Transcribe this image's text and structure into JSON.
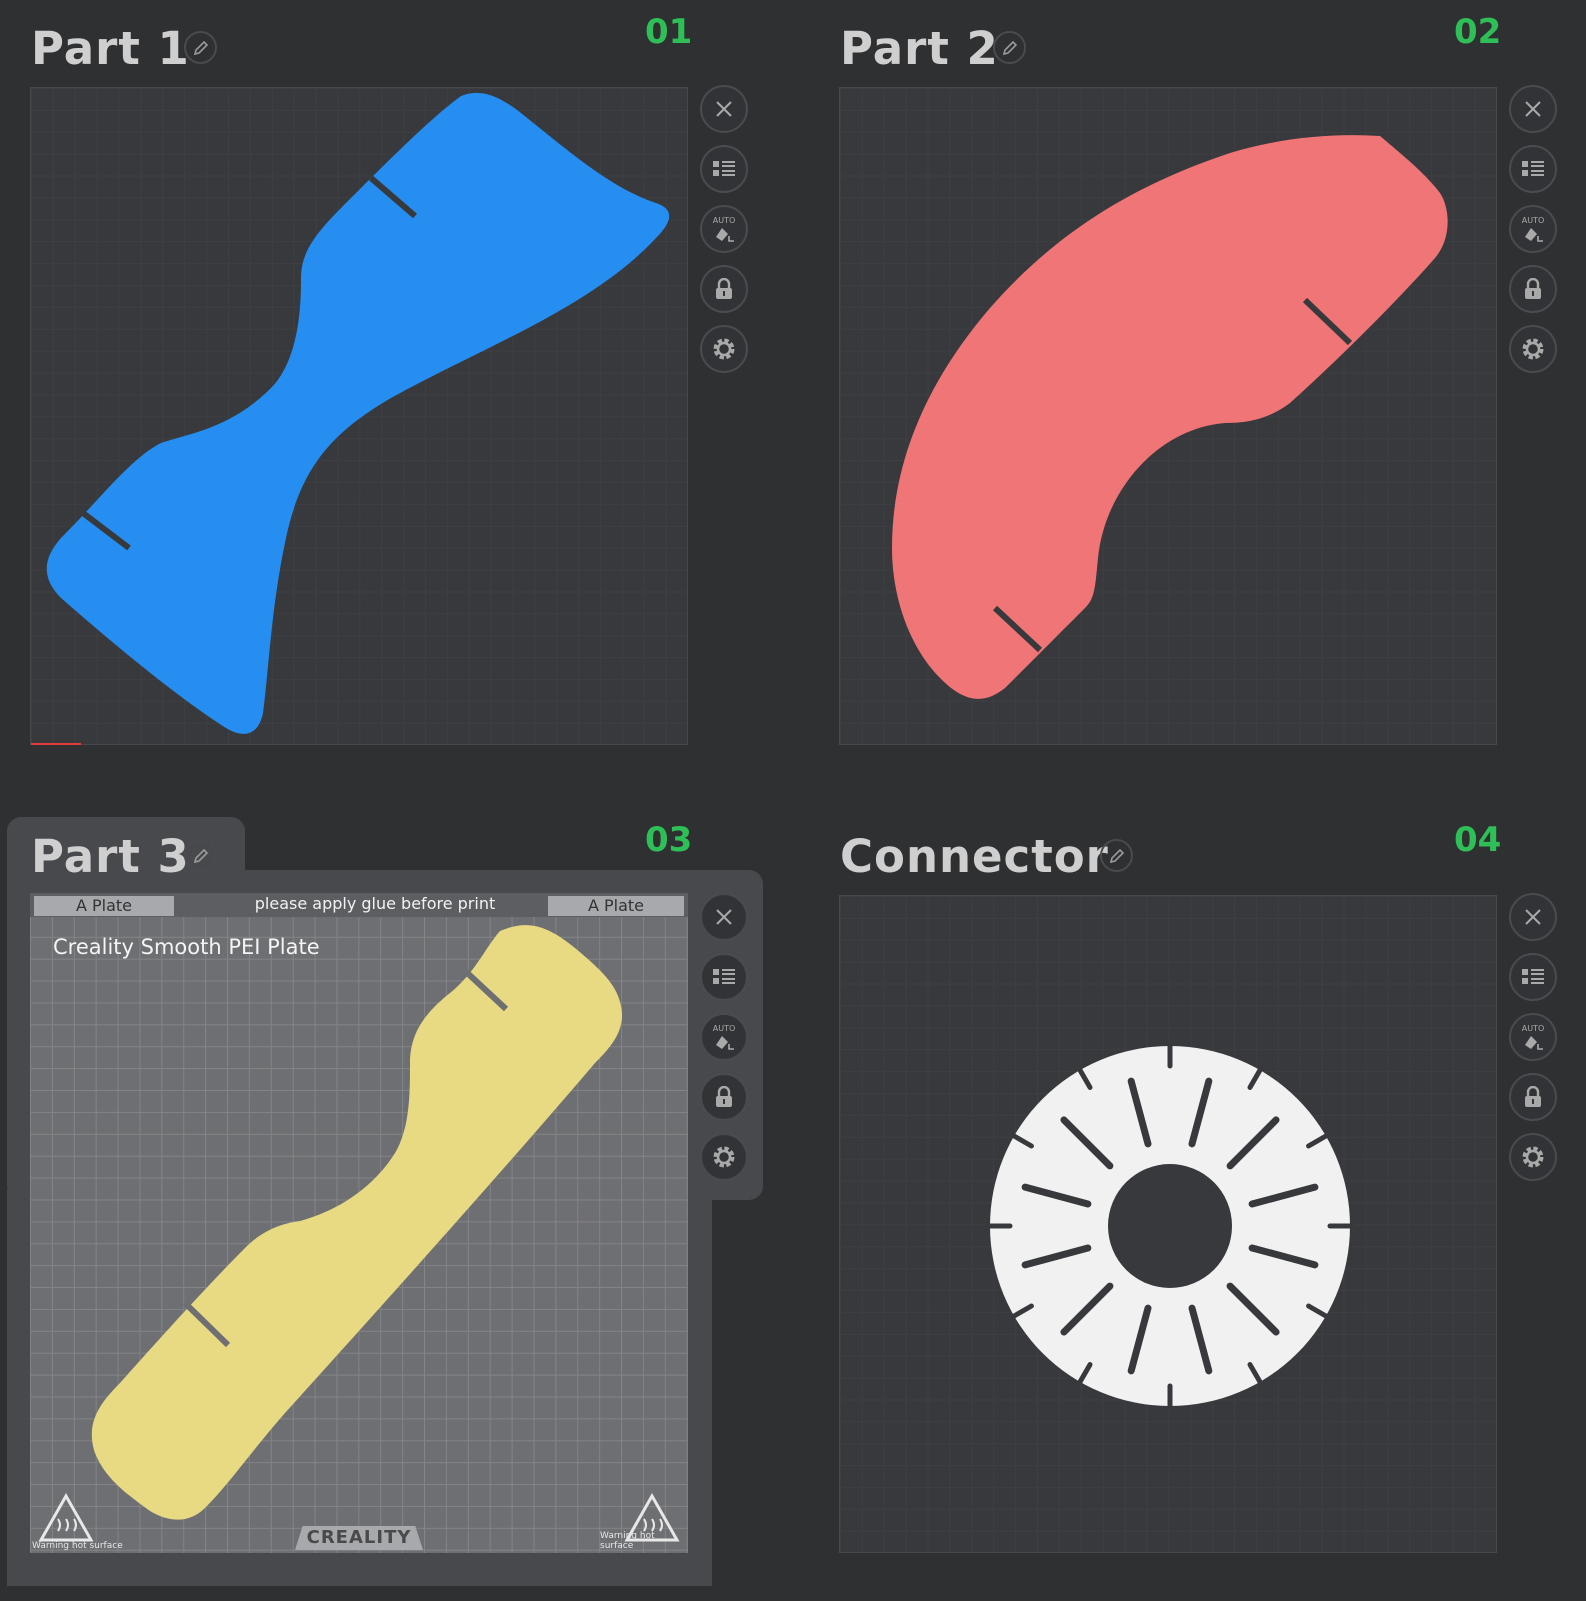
{
  "plates": [
    {
      "title": "Part 1",
      "number": "01"
    },
    {
      "title": "Part 2",
      "number": "02"
    },
    {
      "title": "Part 3",
      "number": "03"
    },
    {
      "title": "Connector",
      "number": "04"
    }
  ],
  "toolbar": {
    "auto_label": "AUTO"
  },
  "active_plate": {
    "left_tag": "A Plate",
    "right_tag": "A Plate",
    "note": "please apply glue before print",
    "plate_type": "Creality Smooth PEI Plate",
    "brand": "CREALITY",
    "warning_left": "Warning hot surface",
    "warning_right": "Warning hot surface"
  },
  "colors": {
    "part1": "#258ef0",
    "part2": "#f07576",
    "part3": "#e8d983",
    "connector": "#f1f1f1",
    "number": "#2fbf57"
  }
}
